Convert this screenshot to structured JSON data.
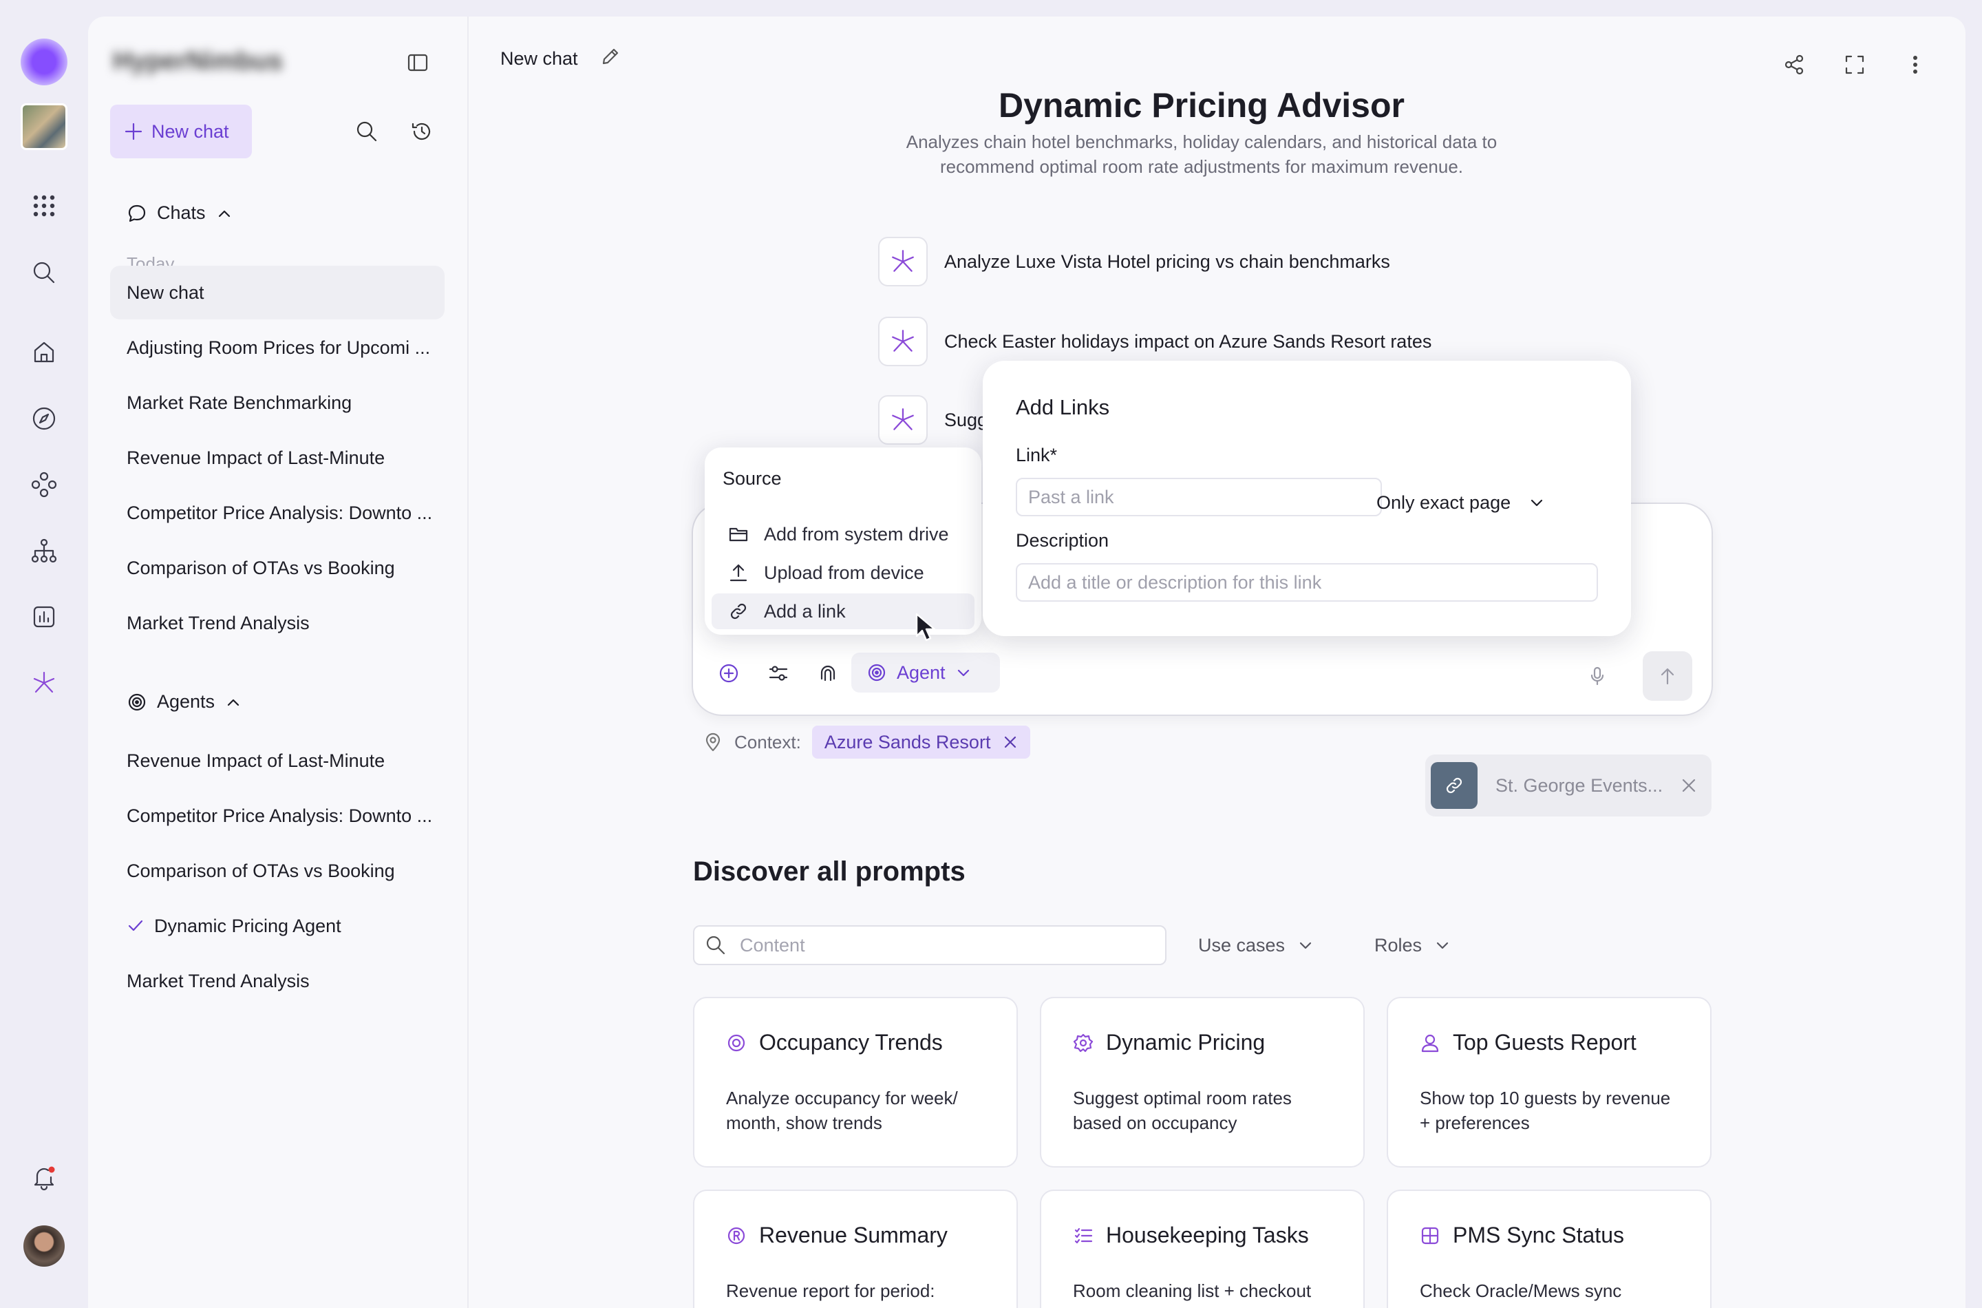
{
  "colors": {
    "accent": "#6b3fd2",
    "accent_light": "#e8dffb",
    "background": "#eeedf6",
    "panel": "#f8f8fb"
  },
  "sidebar": {
    "brand": "HyperNimbus",
    "new_chat": "New chat",
    "chats_header": "Chats",
    "today_label": "Today",
    "chats": [
      "New chat",
      "Adjusting Room Prices for Upcomi ...",
      "Market Rate Benchmarking",
      "Revenue Impact of Last-Minute",
      "Competitor Price Analysis: Downto ...",
      "Comparison of OTAs vs Booking",
      "Market Trend Analysis"
    ],
    "agents_header": "Agents",
    "agents": [
      "Revenue Impact of Last-Minute",
      "Competitor Price Analysis: Downto ...",
      "Comparison of OTAs vs Booking",
      "Dynamic Pricing Agent",
      "Market Trend Analysis"
    ]
  },
  "header": {
    "chat_title": "New chat"
  },
  "main": {
    "title": "Dynamic Pricing Advisor",
    "subtitle_line1": "Analyzes chain hotel benchmarks, holiday calendars, and historical data to",
    "subtitle_line2": "recommend optimal room rate adjustments for maximum revenue.",
    "suggestions": [
      "Analyze Luxe Vista Hotel pricing vs chain benchmarks",
      "Check Easter holidays impact on Azure Sands Resort rates",
      "Sugg"
    ],
    "agent_button": "Agent",
    "context_label": "Context:",
    "context_chip": "Azure Sands Resort",
    "attached_link": "St. George Events...",
    "discover_title": "Discover all prompts",
    "search_placeholder": "Content",
    "filter_use_cases": "Use cases",
    "filter_roles": "Roles",
    "cards": [
      {
        "title": "Occupancy Trends",
        "desc": "Analyze occupancy for week/ month, show trends",
        "icon": "occupancy-icon"
      },
      {
        "title": "Dynamic Pricing",
        "desc": "Suggest optimal room rates based on occupancy",
        "icon": "pricing-icon"
      },
      {
        "title": "Top Guests Report",
        "desc": "Show top 10 guests by revenue + preferences",
        "icon": "guest-icon"
      },
      {
        "title": "Revenue Summary",
        "desc": "Revenue report for period:",
        "icon": "revenue-icon"
      },
      {
        "title": "Housekeeping Tasks",
        "desc": "Room cleaning list + checkout",
        "icon": "tasks-icon"
      },
      {
        "title": "PMS Sync Status",
        "desc": "Check Oracle/Mews sync",
        "icon": "sync-icon"
      }
    ]
  },
  "source_menu": {
    "title": "Source",
    "items": [
      "Add from system drive",
      "Upload from device",
      "Add a link"
    ]
  },
  "add_links": {
    "title": "Add Links",
    "link_label": "Link*",
    "link_placeholder": "Past a link",
    "scope": "Only exact page",
    "description_label": "Description",
    "description_placeholder": "Add a title or description for this link"
  }
}
